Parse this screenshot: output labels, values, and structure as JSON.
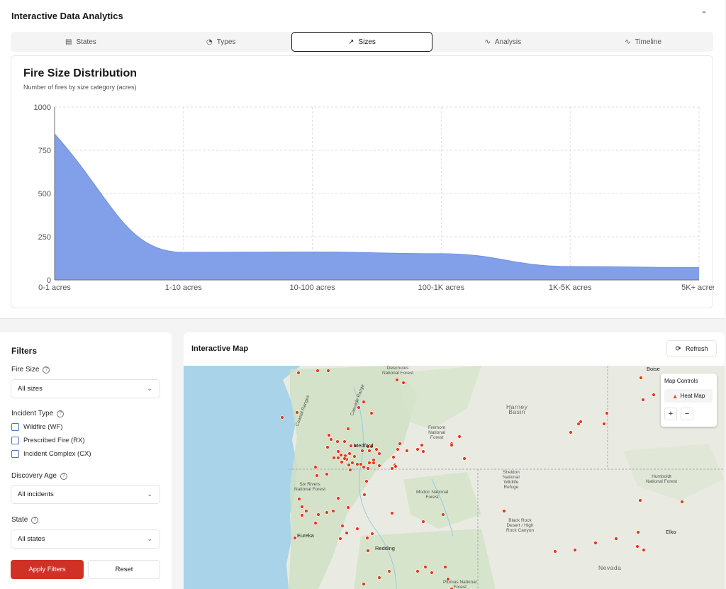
{
  "analytics": {
    "title": "Interactive Data Analytics",
    "collapse_icon": "chevron-up-icon",
    "tabs": [
      {
        "label": "States",
        "icon": "bar-chart-icon"
      },
      {
        "label": "Types",
        "icon": "pie-chart-icon"
      },
      {
        "label": "Sizes",
        "icon": "trending-up-icon",
        "active": true
      },
      {
        "label": "Analysis",
        "icon": "activity-icon"
      },
      {
        "label": "Timeline",
        "icon": "activity-icon"
      }
    ]
  },
  "chart": {
    "title": "Fire Size Distribution",
    "subtitle": "Number of fires by size category (acres)"
  },
  "chart_data": {
    "type": "area",
    "categories": [
      "0-1 acres",
      "1-10 acres",
      "10-100 acres",
      "100-1K acres",
      "1K-5K acres",
      "5K+ acres"
    ],
    "values": [
      845,
      160,
      162,
      152,
      78,
      72
    ],
    "yticks": [
      0,
      250,
      500,
      750,
      1000
    ],
    "ylim": [
      0,
      1000
    ],
    "grid": true,
    "color": "#7b9be8"
  },
  "filters": {
    "title": "Filters",
    "fire_size": {
      "label": "Fire Size",
      "value": "All sizes"
    },
    "incident_type": {
      "label": "Incident Type",
      "options": [
        "Wildfire (WF)",
        "Prescribed Fire (RX)",
        "Incident Complex (CX)"
      ]
    },
    "discovery_age": {
      "label": "Discovery Age",
      "value": "All incidents"
    },
    "state": {
      "label": "State",
      "value": "All states"
    },
    "apply_label": "Apply Filters",
    "reset_label": "Reset"
  },
  "map": {
    "title": "Interactive Map",
    "refresh_label": "Refresh",
    "controls_title": "Map Controls",
    "heat_map_label": "Heat Map",
    "zoom_in": "+",
    "zoom_out": "−",
    "labels": {
      "deschutes": "Deschutes\nNational Forest",
      "boise": "Boise",
      "coastal": "Coastal Ranges",
      "cascade": "Cascade Range",
      "harney": "Harney\nBasin",
      "medford": "Medford",
      "fremont": "Fremont\nNational\nForest",
      "sheldon": "Sheldon\nNational\nWildlife\nRefuge",
      "humboldt": "Humboldt\nNational Forest",
      "six_rivers": "Six Rivers\nNational Forest",
      "modoc": "Modoc National\nForest",
      "black_rock": "Black Rock\nDesert / High\nRock Canyon",
      "eureka": "Eureka",
      "elko": "Elko",
      "redding": "Redding",
      "nevada": "Nevada",
      "plumas": "Plumas National\nForest"
    }
  }
}
